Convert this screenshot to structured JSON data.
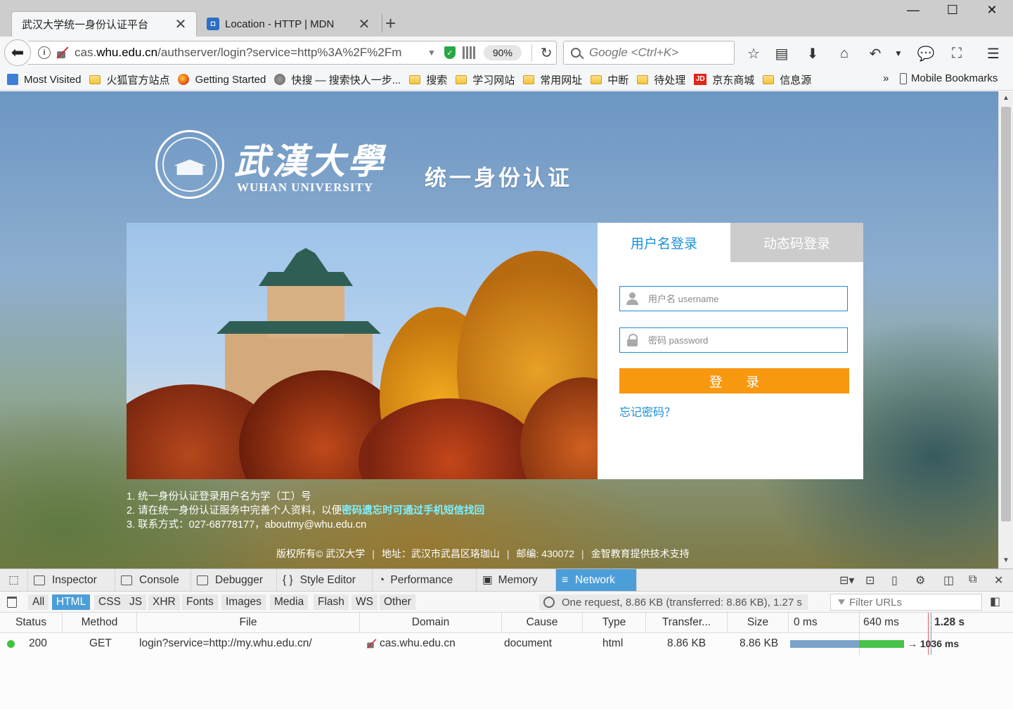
{
  "browser": {
    "tabs": [
      {
        "label": "武汉大学统一身份认证平台",
        "active": true
      },
      {
        "label": "Location - HTTP | MDN",
        "active": false
      }
    ],
    "new_tab_symbol": "+",
    "window_controls": {
      "minimize": "—",
      "maximize": "☐",
      "close": "✕"
    },
    "url_prefix": "cas.",
    "url_domain": "whu.edu.cn",
    "url_rest": "/authserver/login?service=http%3A%2F%2Fm",
    "zoom": "90%",
    "search_placeholder": "Google <Ctrl+K>",
    "bookmarks": [
      {
        "label": "Most Visited",
        "icon": "most-visited-icon"
      },
      {
        "label": "火狐官方站点",
        "icon": "folder-icon"
      },
      {
        "label": "Getting Started",
        "icon": "firefox-icon"
      },
      {
        "label": "快搜 — 搜索快人一步...",
        "icon": "globe-icon"
      },
      {
        "label": "搜索",
        "icon": "folder-icon"
      },
      {
        "label": "学习网站",
        "icon": "folder-icon"
      },
      {
        "label": "常用网址",
        "icon": "folder-icon"
      },
      {
        "label": "中断",
        "icon": "folder-icon"
      },
      {
        "label": "待处理",
        "icon": "folder-icon"
      },
      {
        "label": "京东商城",
        "icon": "jd-icon"
      },
      {
        "label": "信息源",
        "icon": "folder-icon"
      }
    ],
    "bookmarks_more": "»",
    "mobile_bookmarks": "Mobile Bookmarks"
  },
  "page": {
    "logo_cn": "武漢大學",
    "logo_en": "WUHAN UNIVERSITY",
    "heading": "统一身份认证",
    "login": {
      "tab_username": "用户名登录",
      "tab_dynamic": "动态码登录",
      "username_placeholder": "用户名 username",
      "password_placeholder": "密码 password",
      "submit": "登 录",
      "forgot": "忘记密码？"
    },
    "notes": {
      "line1": "1. 统一身份认证登录用户名为学（工）号",
      "line2_prefix": "2. 请在统一身份认证服务中完善个人资料，以便",
      "line2_highlight": "密码遗忘时可通过手机短信找回",
      "line3": "3. 联系方式：027-68778177，aboutmy@whu.edu.cn"
    },
    "footer": {
      "copyright": "版权所有© 武汉大学",
      "address": "地址：武汉市武昌区珞珈山",
      "postcode": "邮编: 430072",
      "support": "金智教育提供技术支持"
    }
  },
  "devtools": {
    "tabs": [
      "Inspector",
      "Console",
      "Debugger",
      "Style Editor",
      "Performance",
      "Memory",
      "Network"
    ],
    "active_tab": "Network",
    "filters": [
      "All",
      "HTML",
      "CSS",
      "JS",
      "XHR",
      "Fonts",
      "Images",
      "Media",
      "Flash",
      "WS",
      "Other"
    ],
    "active_filter": "HTML",
    "summary": "One request, 8.86 KB (transferred: 8.86 KB), 1.27 s",
    "filter_placeholder": "Filter URLs",
    "columns": [
      "Status",
      "Method",
      "File",
      "Domain",
      "Cause",
      "Type",
      "Transfer...",
      "Size"
    ],
    "timeline_ticks": [
      "0 ms",
      "640 ms",
      "1.28 s"
    ],
    "requests": [
      {
        "status": "200",
        "method": "GET",
        "file": "login?service=http://my.whu.edu.cn/",
        "domain": "cas.whu.edu.cn",
        "cause": "document",
        "type": "html",
        "transferred": "8.86 KB",
        "size": "8.86 KB",
        "timing": "→ 1036 ms",
        "status_color": "#3ec43e"
      }
    ]
  },
  "colors": {
    "accent_blue": "#1a8fd6",
    "login_orange": "#f7980f",
    "devtools_active": "#4c9ed9",
    "highlight_cyan": "#7ff0ff"
  }
}
